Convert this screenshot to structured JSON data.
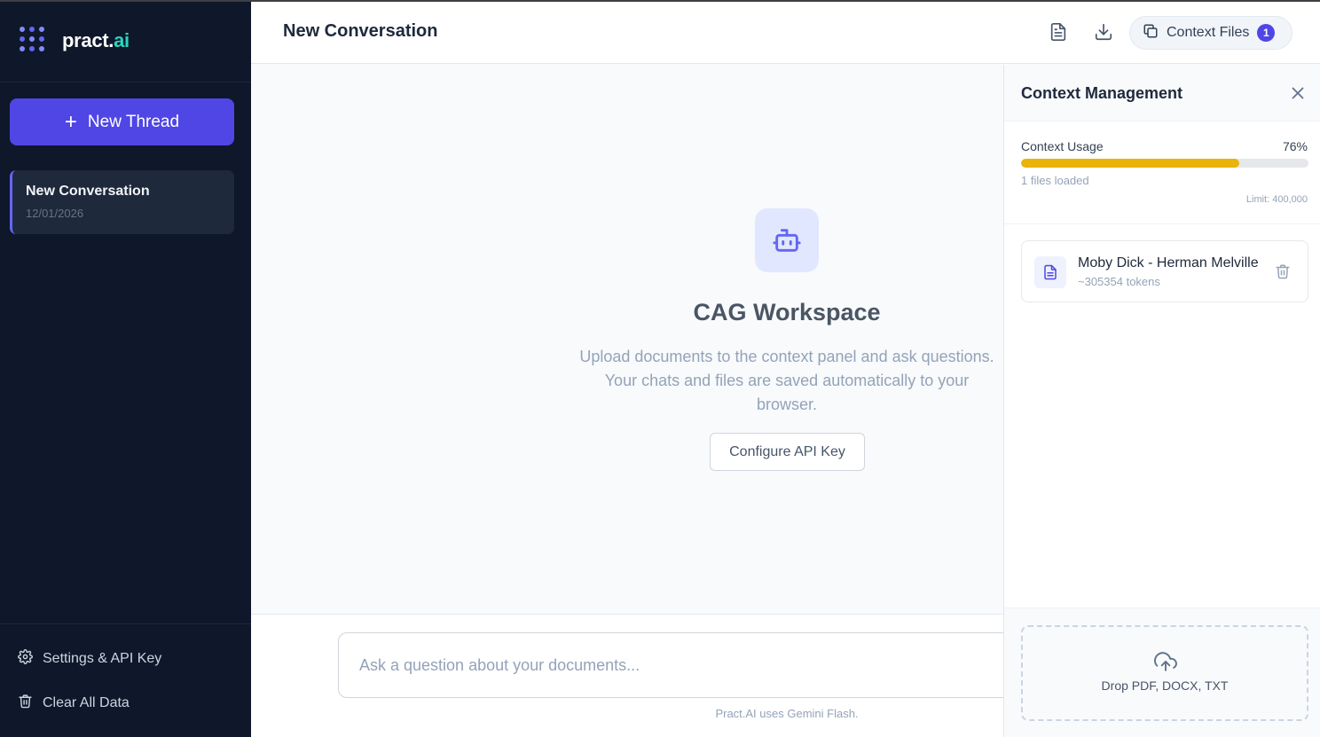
{
  "brand": {
    "name_prefix": "pract.",
    "name_accent": "ai"
  },
  "sidebar": {
    "new_thread_label": "New Thread",
    "threads": [
      {
        "title": "New Conversation",
        "date": "12/01/2026",
        "active": true
      }
    ],
    "settings_label": "Settings & API Key",
    "clear_label": "Clear All Data"
  },
  "header": {
    "title": "New Conversation",
    "context_button_label": "Context Files",
    "context_count": "1",
    "icons": [
      "document-icon",
      "download-icon",
      "files-icon"
    ]
  },
  "workspace": {
    "icon": "robot-icon",
    "title": "CAG Workspace",
    "description_lines": [
      "Upload documents to the context panel and ask questions.",
      "Your chats and files are saved automatically to your",
      "browser."
    ],
    "configure_button_label": "Configure API Key"
  },
  "composer": {
    "placeholder": "Ask a question about your documents...",
    "footnote": "Pract.AI uses Gemini Flash."
  },
  "context_panel": {
    "title": "Context Management",
    "usage_label": "Context Usage",
    "usage_percent_text": "76%",
    "usage_fraction": 0.76,
    "files_loaded": "1 files loaded",
    "limit": "Limit: 400,000",
    "files": [
      {
        "name": "Moby Dick - Herman Melville",
        "tokens": "~305354 tokens"
      }
    ],
    "dropzone_label": "Drop PDF, DOCX, TXT"
  },
  "colors": {
    "sidebar_bg": "#0f172a",
    "accent": "#4f46e5",
    "brand_accent": "#2dd4bf",
    "usage_bar": "#eab308"
  }
}
